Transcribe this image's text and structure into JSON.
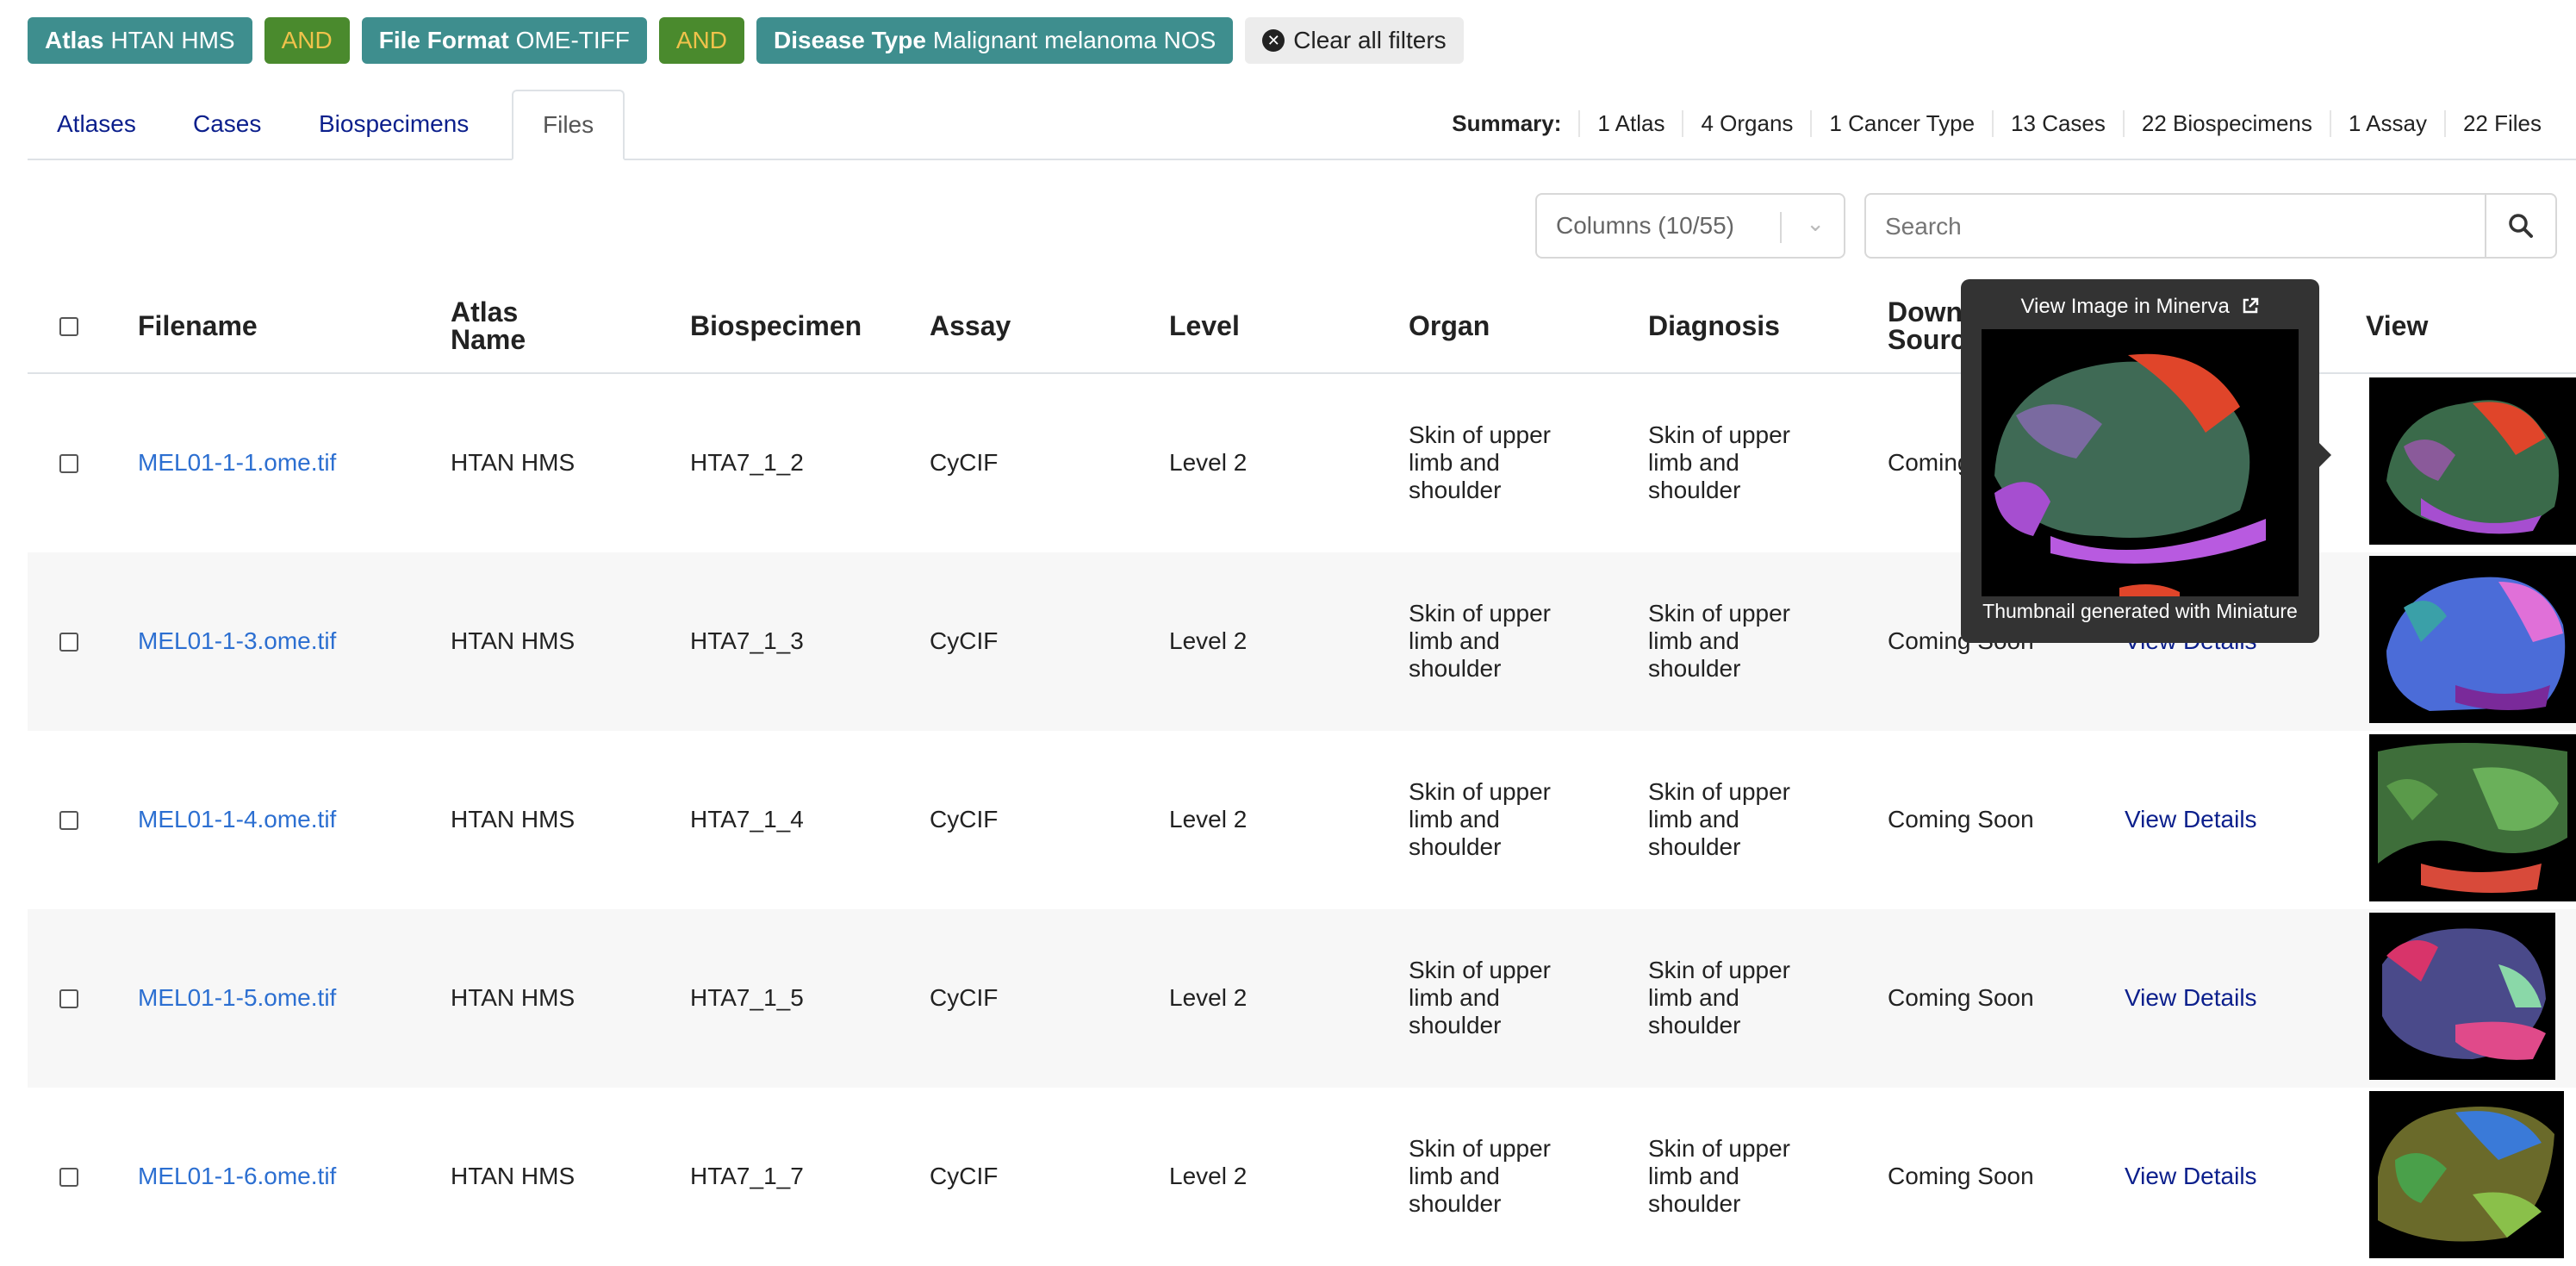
{
  "filters": {
    "atlas_label": "Atlas",
    "atlas_value": "HTAN HMS",
    "and1": "AND",
    "file_format_label": "File Format",
    "file_format_value": "OME-TIFF",
    "and2": "AND",
    "disease_label": "Disease Type",
    "disease_value": "Malignant melanoma NOS",
    "clear_label": "Clear all filters"
  },
  "tabs": [
    "Atlases",
    "Cases",
    "Biospecimens",
    "Files"
  ],
  "active_tab": "Files",
  "summary": {
    "label": "Summary:",
    "items": [
      "1 Atlas",
      "4 Organs",
      "1 Cancer Type",
      "13 Cases",
      "22 Biospecimens",
      "1 Assay",
      "22 Files"
    ]
  },
  "controls": {
    "columns_label": "Columns (10/55)",
    "search_placeholder": "Search"
  },
  "table": {
    "headers": {
      "filename": "Filename",
      "atlas_name_1": "Atlas",
      "atlas_name_2": "Name",
      "biospecimen": "Biospecimen",
      "assay": "Assay",
      "level": "Level",
      "organ": "Organ",
      "diagnosis": "Diagnosis",
      "download_1": "Down",
      "download_2": "Sourc",
      "view": "View"
    },
    "rows": [
      {
        "filename": "MEL01-1-1.ome.tif",
        "atlas": "HTAN HMS",
        "biospecimen": "HTA7_1_2",
        "assay": "CyCIF",
        "level": "Level 2",
        "organ": [
          "Skin of upper",
          "limb and",
          "shoulder"
        ],
        "diagnosis": [
          "Skin of upper",
          "limb and",
          "shoulder"
        ],
        "download": "Coming",
        "details": ""
      },
      {
        "filename": "MEL01-1-3.ome.tif",
        "atlas": "HTAN HMS",
        "biospecimen": "HTA7_1_3",
        "assay": "CyCIF",
        "level": "Level 2",
        "organ": [
          "Skin of upper",
          "limb and",
          "shoulder"
        ],
        "diagnosis": [
          "Skin of upper",
          "limb and",
          "shoulder"
        ],
        "download": "Coming Soon",
        "details": "View Details"
      },
      {
        "filename": "MEL01-1-4.ome.tif",
        "atlas": "HTAN HMS",
        "biospecimen": "HTA7_1_4",
        "assay": "CyCIF",
        "level": "Level 2",
        "organ": [
          "Skin of upper",
          "limb and",
          "shoulder"
        ],
        "diagnosis": [
          "Skin of upper",
          "limb and",
          "shoulder"
        ],
        "download": "Coming Soon",
        "details": "View Details"
      },
      {
        "filename": "MEL01-1-5.ome.tif",
        "atlas": "HTAN HMS",
        "biospecimen": "HTA7_1_5",
        "assay": "CyCIF",
        "level": "Level 2",
        "organ": [
          "Skin of upper",
          "limb and",
          "shoulder"
        ],
        "diagnosis": [
          "Skin of upper",
          "limb and",
          "shoulder"
        ],
        "download": "Coming Soon",
        "details": "View Details"
      },
      {
        "filename": "MEL01-1-6.ome.tif",
        "atlas": "HTAN HMS",
        "biospecimen": "HTA7_1_7",
        "assay": "CyCIF",
        "level": "Level 2",
        "organ": [
          "Skin of upper",
          "limb and",
          "shoulder"
        ],
        "diagnosis": [
          "Skin of upper",
          "limb and",
          "shoulder"
        ],
        "download": "Coming Soon",
        "details": "View Details"
      }
    ]
  },
  "tooltip": {
    "title": "View Image in Minerva",
    "caption": "Thumbnail generated with Miniature"
  },
  "colors": {
    "filter_pill": "#3e8e8e",
    "and_pill": "#4a8a2d",
    "and_text": "#f0c24b",
    "link": "#2c6fd1",
    "details_link": "#0b1f8c"
  }
}
